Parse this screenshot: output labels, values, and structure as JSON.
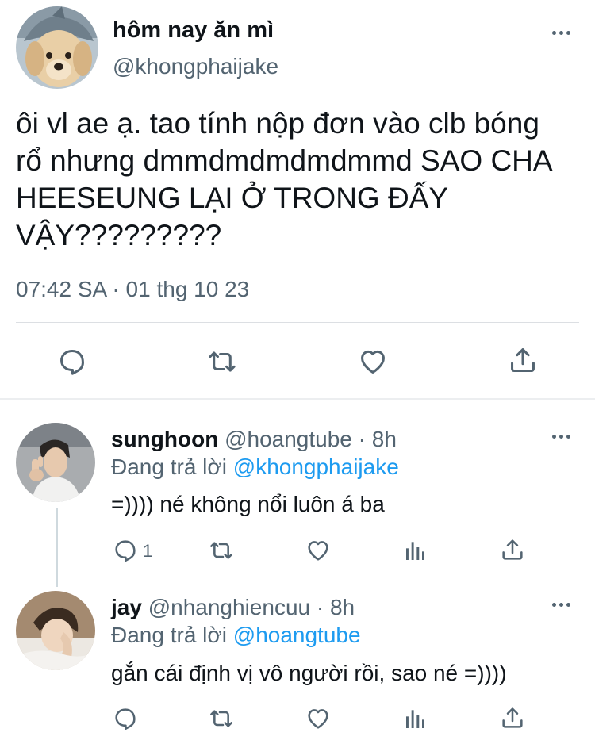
{
  "main_tweet": {
    "display_name": "hôm nay ăn mì",
    "handle": "@khongphaijake",
    "text": "ôi vl ae ạ. tao tính nộp đơn vào clb bóng rổ nhưng dmmdmdmdmdmmd SAO CHA HEESEUNG LẠI Ở TRONG ĐẤY VẬY?????????",
    "timestamp": "07:42 SA · 01 thg 10 23",
    "avatar": "puppy-with-shark-hat"
  },
  "main_actions": [
    {
      "name": "reply-icon"
    },
    {
      "name": "retweet-icon"
    },
    {
      "name": "like-icon"
    },
    {
      "name": "share-icon"
    }
  ],
  "replies": [
    {
      "display_name": "sunghoon",
      "meta": "@hoangtube · 8h",
      "replying_prefix": "Đang trả lời",
      "replying_to": "@khongphaijake",
      "text": "=)))) né không nổi luôn á ba",
      "reply_count": "1",
      "avatar": "man-peace-sign"
    },
    {
      "display_name": "jay",
      "meta": "@nhanghiencuu · 8h",
      "replying_prefix": "Đang trả lời",
      "replying_to": "@hoangtube",
      "text": "gắn cái định vị vô người rồi, sao né =))))",
      "reply_count": "",
      "avatar": "man-hand-on-cheek"
    }
  ],
  "colors": {
    "text": "#0f1419",
    "secondary": "#536471",
    "link": "#1d9bf0",
    "divider": "#dcdfe3"
  }
}
